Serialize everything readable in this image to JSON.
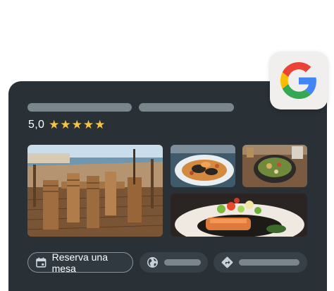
{
  "listing": {
    "rating_value": "5,0",
    "stars": "★★★★★",
    "rating": 5.0
  },
  "actions": {
    "reserve_label": "Reserva una mesa",
    "reserve_icon": "calendar-icon",
    "website_icon": "globe-icon",
    "directions_icon": "directions-icon"
  },
  "photos": [
    "terrace-photo",
    "seafood-pasta-photo",
    "salad-bowl-photo",
    "salmon-dish-photo"
  ],
  "brand": {
    "logo": "google-logo",
    "colors": {
      "blue": "#4285F4",
      "red": "#EA4335",
      "yellow": "#FBBC05",
      "green": "#34A853",
      "card_background": "#293036",
      "star": "#f6c344"
    }
  }
}
